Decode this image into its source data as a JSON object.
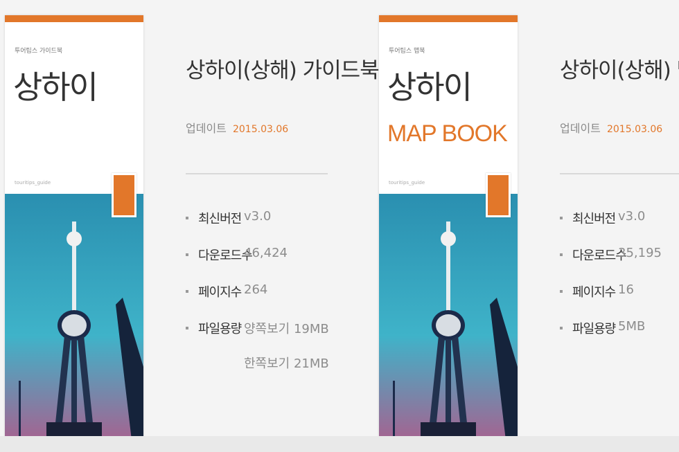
{
  "colors": {
    "accent": "#e2772a",
    "background": "#f4f4f4"
  },
  "books": [
    {
      "cover": {
        "small": "투어팁스 가이드북",
        "city": "상하이",
        "sub": "",
        "tiny": "touritips_guide"
      },
      "title": "상하이(상해) 가이드북",
      "update_label": "업데이트",
      "update_date": "2015.03.06",
      "stats": [
        {
          "label": "최신버전",
          "value": "v3.0"
        },
        {
          "label": "다운로드수",
          "value": "46,424"
        },
        {
          "label": "페이지수",
          "value": "264"
        },
        {
          "label": "파일용량",
          "value": "양쪽보기 19MB",
          "value2": "한쪽보기 21MB"
        }
      ]
    },
    {
      "cover": {
        "small": "투어팁스 맵북",
        "city": "상하이",
        "sub": "MAP BOOK",
        "tiny": "touritips_guide"
      },
      "title": "상하이(상해) 맵북",
      "update_label": "업데이트",
      "update_date": "2015.03.06",
      "stats": [
        {
          "label": "최신버전",
          "value": "v3.0"
        },
        {
          "label": "다운로드수",
          "value": "35,195"
        },
        {
          "label": "페이지수",
          "value": "16"
        },
        {
          "label": "파일용량",
          "value": "5MB"
        }
      ]
    }
  ]
}
